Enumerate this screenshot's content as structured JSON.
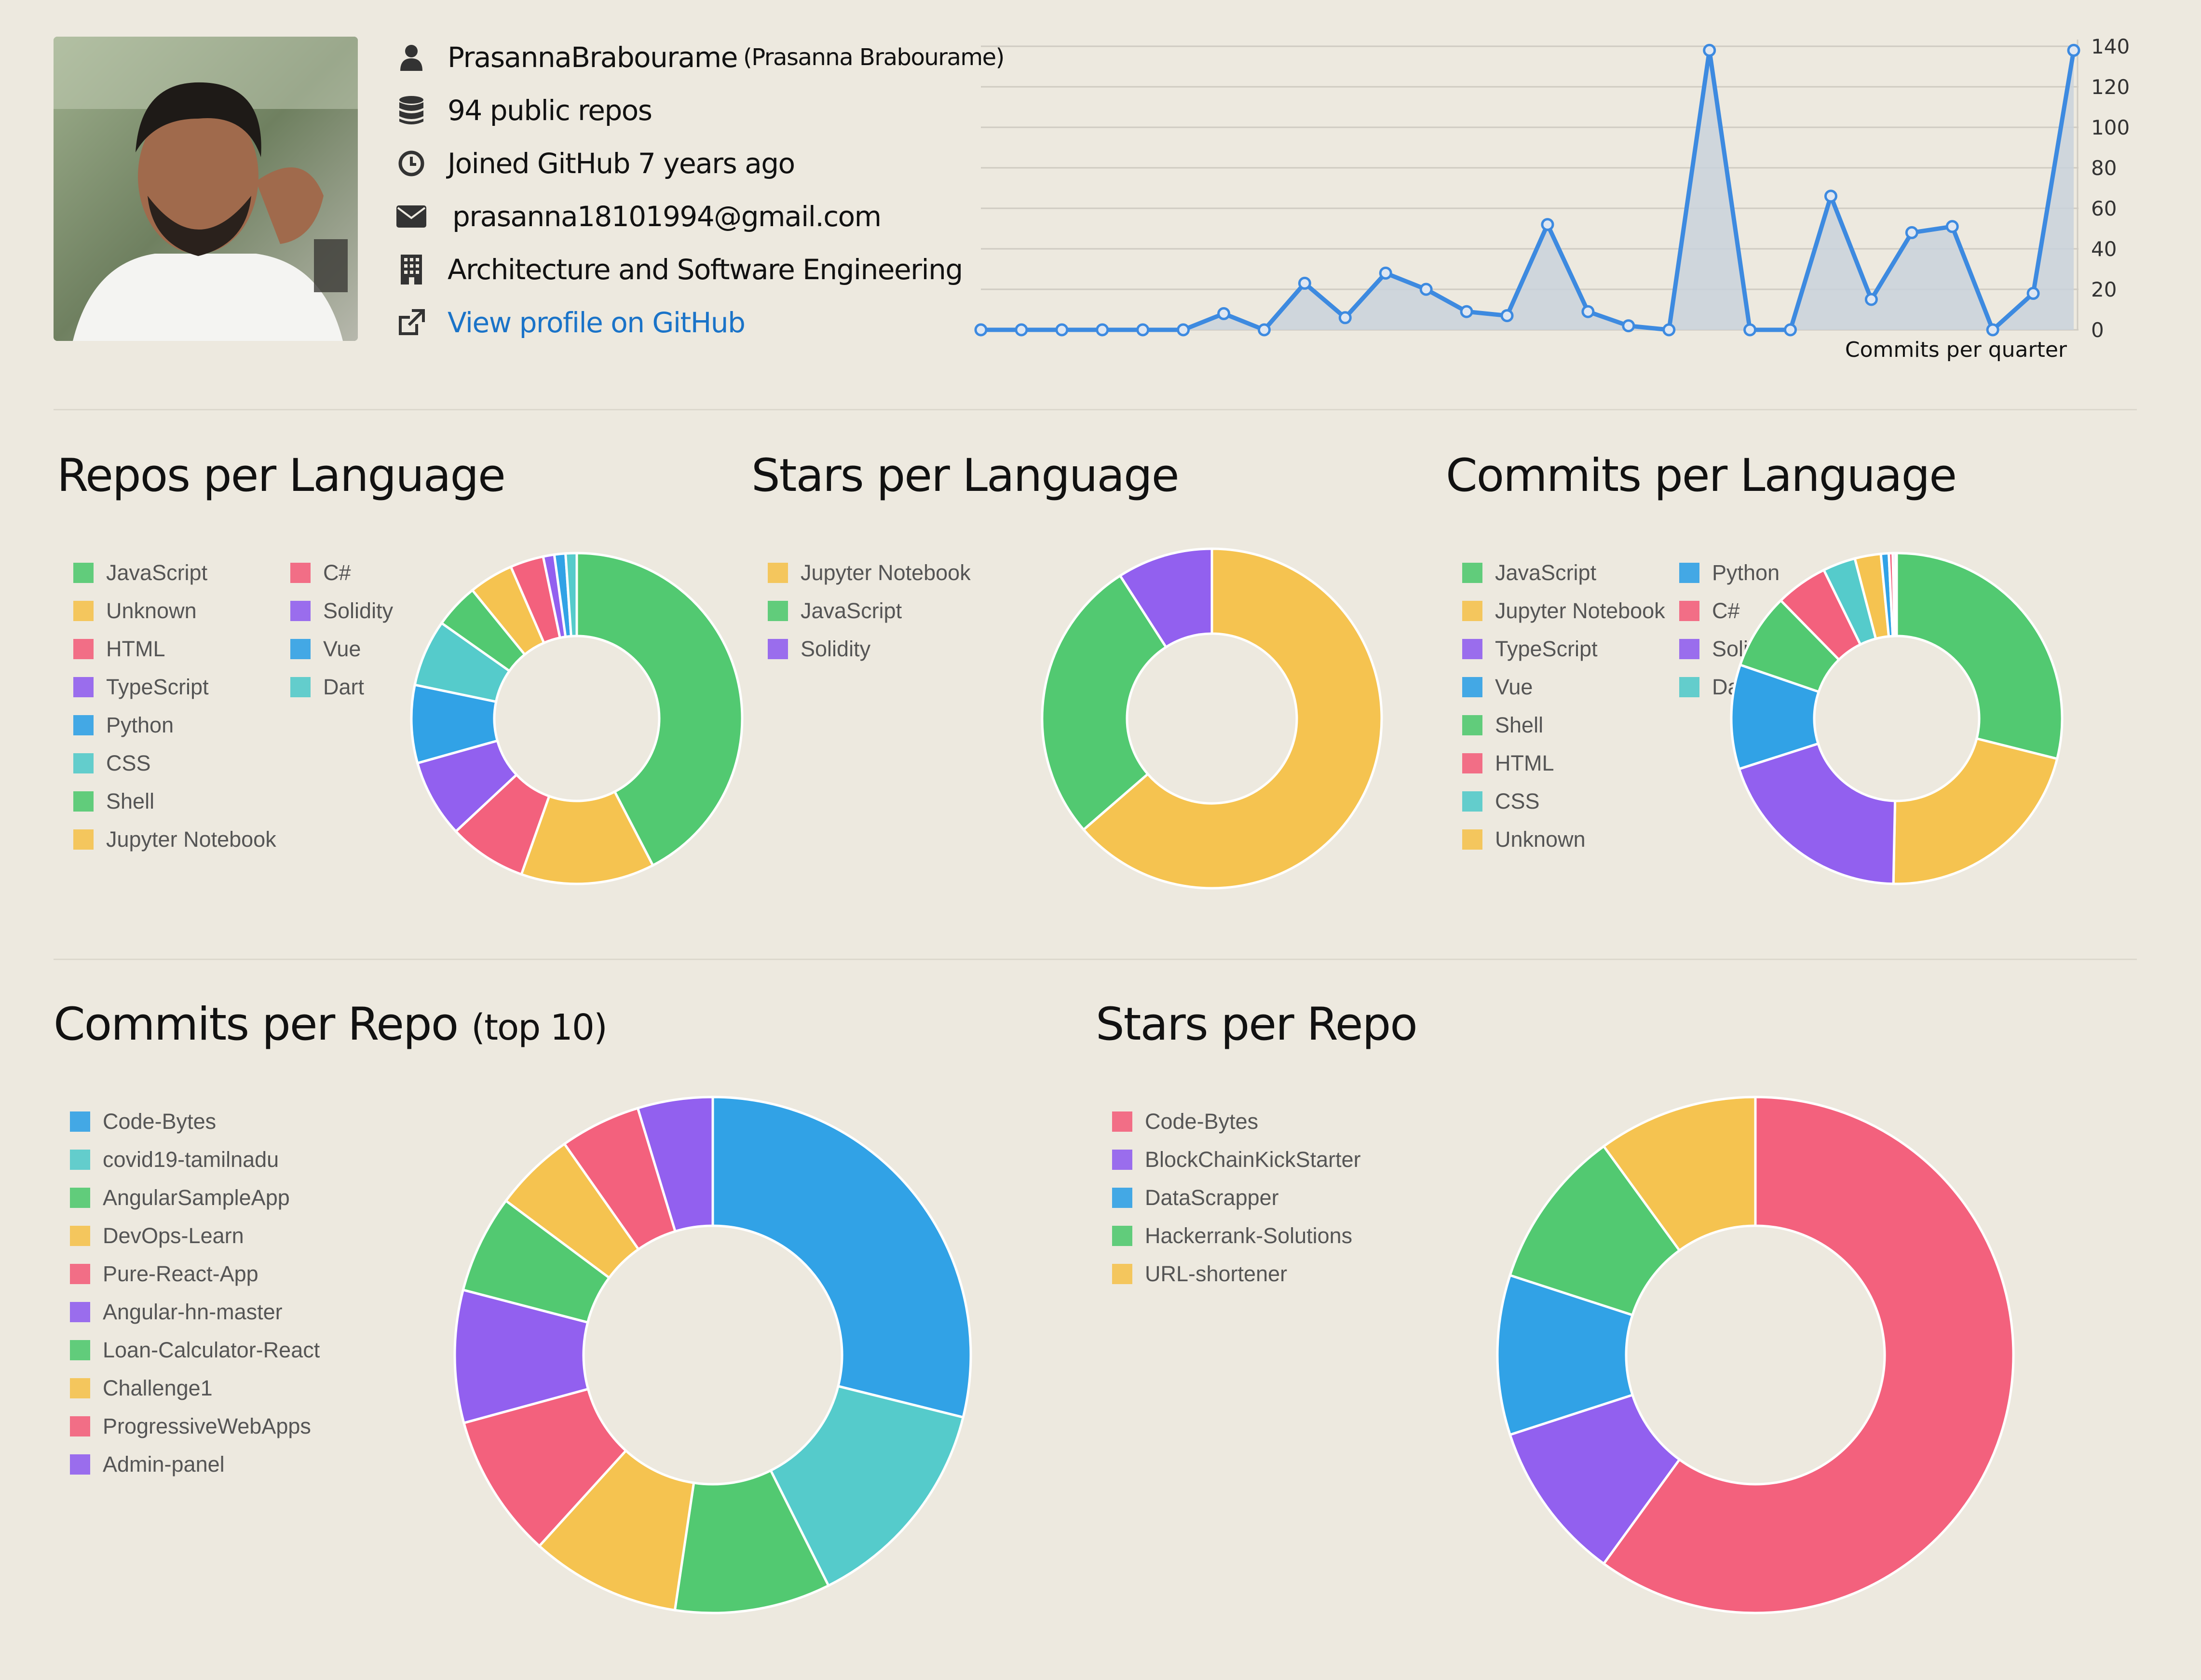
{
  "profile": {
    "username": "PrasannaBrabourame",
    "fullname": "(Prasanna Brabourame)",
    "repos": "94 public repos",
    "joined": "Joined GitHub 7 years ago",
    "email": "prasanna18101994@gmail.com",
    "company": "Architecture and Software Engineering",
    "profile_link": "View profile on GitHub"
  },
  "icons": {
    "user": "user-icon",
    "repos": "database-icon",
    "joined": "clock-icon",
    "email": "envelope-icon",
    "company": "building-icon",
    "link": "external-link-icon"
  },
  "commits_chart": {
    "type": "area",
    "xlabel": "Commits per quarter",
    "ylim": [
      0,
      140
    ],
    "yticks": [
      "0",
      "20",
      "40",
      "60",
      "80",
      "100",
      "120",
      "140"
    ],
    "values": [
      0,
      0,
      0,
      0,
      0,
      0,
      8,
      0,
      23,
      6,
      28,
      20,
      9,
      7,
      52,
      9,
      2,
      0,
      138,
      0,
      0,
      66,
      15,
      48,
      51,
      0,
      18,
      138
    ],
    "line_color": "#3d8ae0",
    "fill_color": "#c9d2dc"
  },
  "sections": {
    "repos_per_language": "Repos per Language",
    "stars_per_language": "Stars per Language",
    "commits_per_language": "Commits per Language",
    "commits_per_repo": "Commits per Repo",
    "commits_per_repo_suffix": "(top 10)",
    "stars_per_repo": "Stars per Repo"
  },
  "chart_data": [
    {
      "type": "pie",
      "title": "Repos per Language",
      "categories": [
        "JavaScript",
        "Unknown",
        "HTML",
        "TypeScript",
        "Python",
        "CSS",
        "Shell",
        "Jupyter Notebook",
        "C#",
        "Solidity",
        "Vue",
        "Dart"
      ],
      "values": [
        39,
        12,
        7,
        7,
        7,
        6,
        4,
        4,
        3,
        1,
        1,
        1
      ],
      "colors": [
        "#52c971",
        "#f5c350",
        "#f3617d",
        "#9260ef",
        "#31a2e6",
        "#55cbcb",
        "#52c971",
        "#f5c350",
        "#f3617d",
        "#9260ef",
        "#31a2e6",
        "#55cbcb"
      ]
    },
    {
      "type": "pie",
      "title": "Stars per Language",
      "categories": [
        "Jupyter Notebook",
        "JavaScript",
        "Solidity"
      ],
      "values": [
        7,
        3,
        1
      ],
      "colors": [
        "#f5c350",
        "#52c971",
        "#9260ef"
      ]
    },
    {
      "type": "pie",
      "title": "Commits per Language",
      "categories": [
        "JavaScript",
        "Jupyter Notebook",
        "TypeScript",
        "Vue",
        "Shell",
        "HTML",
        "CSS",
        "Unknown",
        "Python",
        "C#",
        "Solidity",
        "Dart"
      ],
      "values": [
        227,
        168,
        155,
        80,
        58,
        40,
        25,
        20,
        6,
        3,
        2,
        1
      ],
      "colors": [
        "#52c971",
        "#f5c350",
        "#9260ef",
        "#31a2e6",
        "#52c971",
        "#f3617d",
        "#55cbcb",
        "#f5c350",
        "#31a2e6",
        "#f3617d",
        "#9260ef",
        "#55cbcb"
      ]
    },
    {
      "type": "pie",
      "title": "Commits per Repo (top 10)",
      "categories": [
        "Code-Bytes",
        "covid19-tamilnadu",
        "AngularSampleApp",
        "DevOps-Learn",
        "Pure-React-App",
        "Angular-hn-master",
        "Loan-Calculator-React",
        "Challenge1",
        "ProgressiveWebApps",
        "Admin-panel"
      ],
      "values": [
        80,
        38,
        27,
        26,
        25,
        23,
        17,
        14,
        14,
        13
      ],
      "colors": [
        "#31a2e6",
        "#55cbcb",
        "#52c971",
        "#f5c350",
        "#f3617d",
        "#9260ef",
        "#52c971",
        "#f5c350",
        "#f3617d",
        "#9260ef"
      ]
    },
    {
      "type": "pie",
      "title": "Stars per Repo",
      "categories": [
        "Code-Bytes",
        "BlockChainKickStarter",
        "DataScrapper",
        "Hackerrank-Solutions",
        "URL-shortener"
      ],
      "values": [
        6,
        1,
        1,
        1,
        1
      ],
      "colors": [
        "#f3617d",
        "#9260ef",
        "#31a2e6",
        "#52c971",
        "#f5c350"
      ]
    }
  ]
}
